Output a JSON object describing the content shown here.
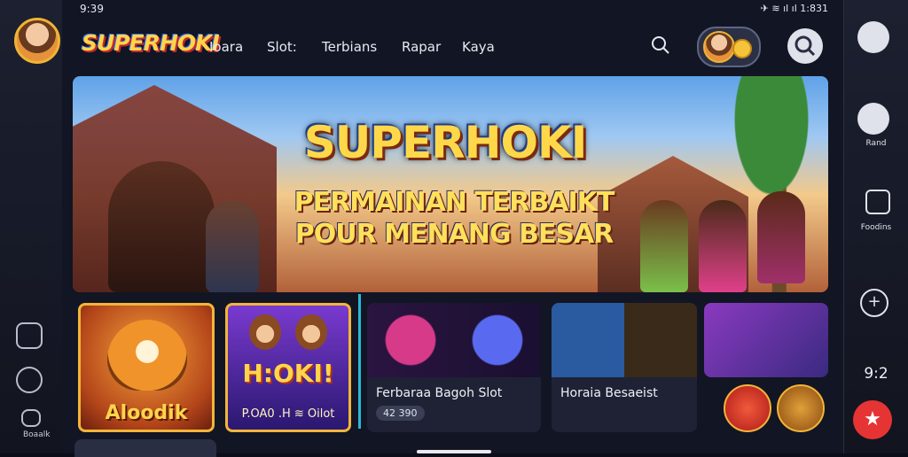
{
  "status_bar": {
    "time": "9:39",
    "right": "✈ ≋ ıl ıl 1:831"
  },
  "header": {
    "logo": "SUPERHOKI",
    "nav": [
      "Ioara",
      "Slot:",
      "Terbians",
      "Rapar",
      "Kaya"
    ]
  },
  "hero": {
    "title": "SUPERHOKI",
    "subtitle_line1": "PERMAINAN TERBAIKT",
    "subtitle_line2": "POUR MENANG BESAR"
  },
  "cards": [
    {
      "label": "Aloodik"
    },
    {
      "title": "H:OKI!",
      "subtitle": "P.OA0 .H ≋ Oilot"
    },
    {
      "title": "Ferbaraa Bagoh Slot",
      "badge": "42 390"
    },
    {
      "title": "Horaia Besaeist"
    }
  ],
  "left_rail": {
    "label_bottom": "Boaalk"
  },
  "right_rail": {
    "label_1": "Rand",
    "label_2": "Foodins",
    "plus": "+",
    "number": "9:2",
    "star": "★"
  },
  "colors": {
    "accent": "#f2b53a",
    "brand": "#ffd54a",
    "danger": "#e63434",
    "teal": "#2bb8d8"
  },
  "icons": [
    "search-icon",
    "profile-avatar",
    "coin-icon",
    "gear-icon",
    "heart-icon",
    "share-icon",
    "plus-icon",
    "star-icon",
    "copy-icon",
    "refresh-icon",
    "home-icon"
  ]
}
